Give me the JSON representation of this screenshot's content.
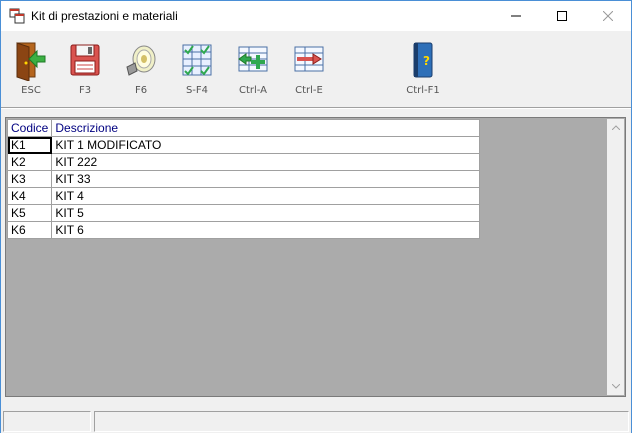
{
  "window": {
    "title": "Kit di prestazioni e materiali"
  },
  "toolbar": {
    "buttons": [
      {
        "label": "ESC",
        "icon": "exit-door-icon"
      },
      {
        "label": "F3",
        "icon": "floppy-save-icon"
      },
      {
        "label": "F6",
        "icon": "flashlight-search-icon"
      },
      {
        "label": "S-F4",
        "icon": "grid-check-icon"
      },
      {
        "label": "Ctrl-A",
        "icon": "grid-add-icon"
      },
      {
        "label": "Ctrl-E",
        "icon": "grid-remove-icon"
      },
      {
        "label": "Ctrl-F1",
        "icon": "help-book-icon"
      }
    ]
  },
  "grid": {
    "headers": {
      "code": "Codice",
      "description": "Descrizione"
    },
    "rows": [
      {
        "code": "K1",
        "description": "KIT 1 MODIFICATO"
      },
      {
        "code": "K2",
        "description": "KIT 222"
      },
      {
        "code": "K3",
        "description": "KIT 33"
      },
      {
        "code": "K4",
        "description": "KIT 4"
      },
      {
        "code": "K5",
        "description": "KIT 5"
      },
      {
        "code": "K6",
        "description": "KIT 6"
      }
    ]
  },
  "statusbar": {
    "cells": [
      "",
      ""
    ]
  },
  "colors": {
    "header_text": "#000080",
    "grid_background": "#ababab",
    "window_border": "#4a8fd6"
  }
}
